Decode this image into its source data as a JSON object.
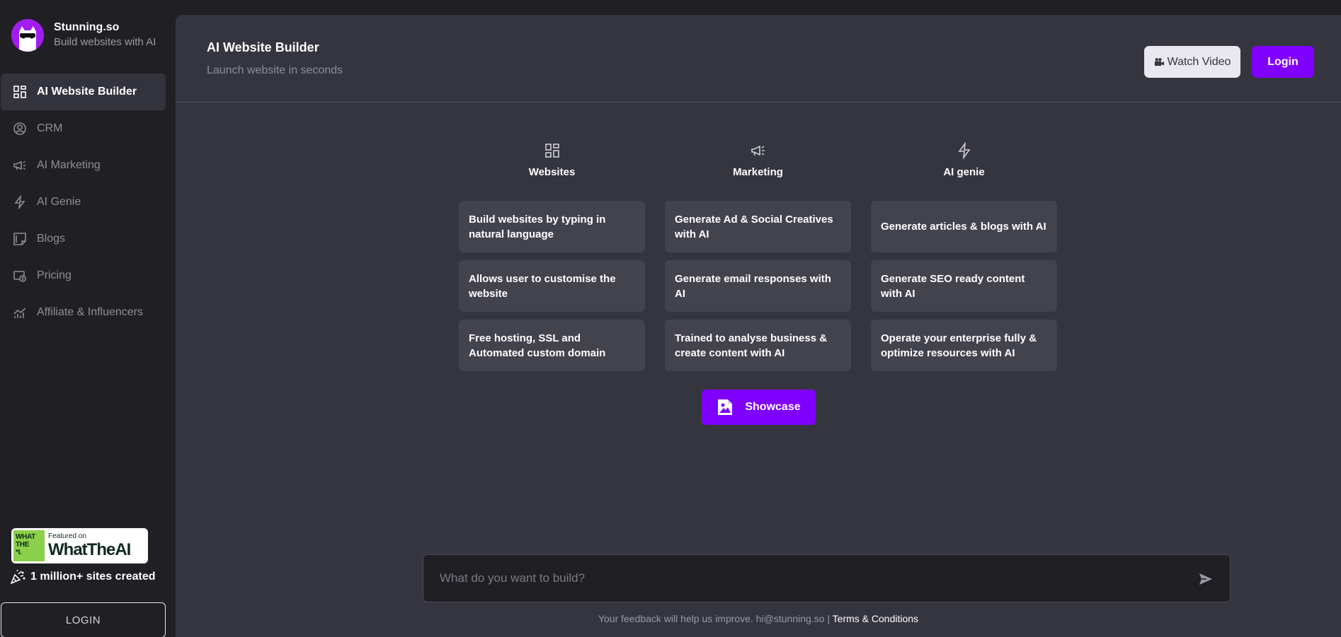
{
  "brand": {
    "name": "Stunning.so",
    "tagline": "Build websites with AI"
  },
  "sidebar": {
    "items": [
      {
        "label": "AI Website Builder",
        "icon": "grid-icon",
        "active": true
      },
      {
        "label": "CRM",
        "icon": "user-circle-icon"
      },
      {
        "label": "AI Marketing",
        "icon": "megaphone-icon"
      },
      {
        "label": "AI Genie",
        "icon": "lightning-icon"
      },
      {
        "label": "Blogs",
        "icon": "sticky-note-icon"
      },
      {
        "label": "Pricing",
        "icon": "price-tag-icon"
      },
      {
        "label": "Affiliate & Influencers",
        "icon": "chart-icon"
      }
    ],
    "featured": {
      "logo_lines": [
        "WHAT",
        "THE",
        "*I."
      ],
      "small": "Featured on",
      "big": "WhatTheAI"
    },
    "sites_created": "1 million+ sites created",
    "login_label": "LOGIN"
  },
  "header": {
    "title": "AI Website Builder",
    "subtitle": "Launch website in seconds",
    "watch_video": "Watch Video",
    "login": "Login"
  },
  "columns": [
    {
      "title": "Websites",
      "icon": "grid-icon",
      "cards": [
        "Build websites by typing in natural language",
        "Allows user to customise the website",
        "Free hosting, SSL and Automated custom domain"
      ]
    },
    {
      "title": "Marketing",
      "icon": "megaphone-icon",
      "cards": [
        "Generate Ad & Social Creatives with AI",
        "Generate email responses with AI",
        "Trained to analyse business & create content with AI"
      ]
    },
    {
      "title": "AI genie",
      "icon": "lightning-icon",
      "cards": [
        "Generate articles & blogs with AI",
        "Generate SEO ready content with AI",
        "Operate your enterprise fully & optimize resources with AI"
      ]
    }
  ],
  "showcase": "Showcase",
  "prompt": {
    "placeholder": "What do you want to build?",
    "value": ""
  },
  "footer": {
    "feedback": "Your feedback will help us improve. hi@stunning.so |",
    "terms": "Terms & Conditions"
  },
  "colors": {
    "accent": "#8000ff",
    "sidebar_bg": "#202024",
    "main_bg": "#35353f",
    "card_bg": "#43434e",
    "avatar_bg": "#a21cf0"
  }
}
